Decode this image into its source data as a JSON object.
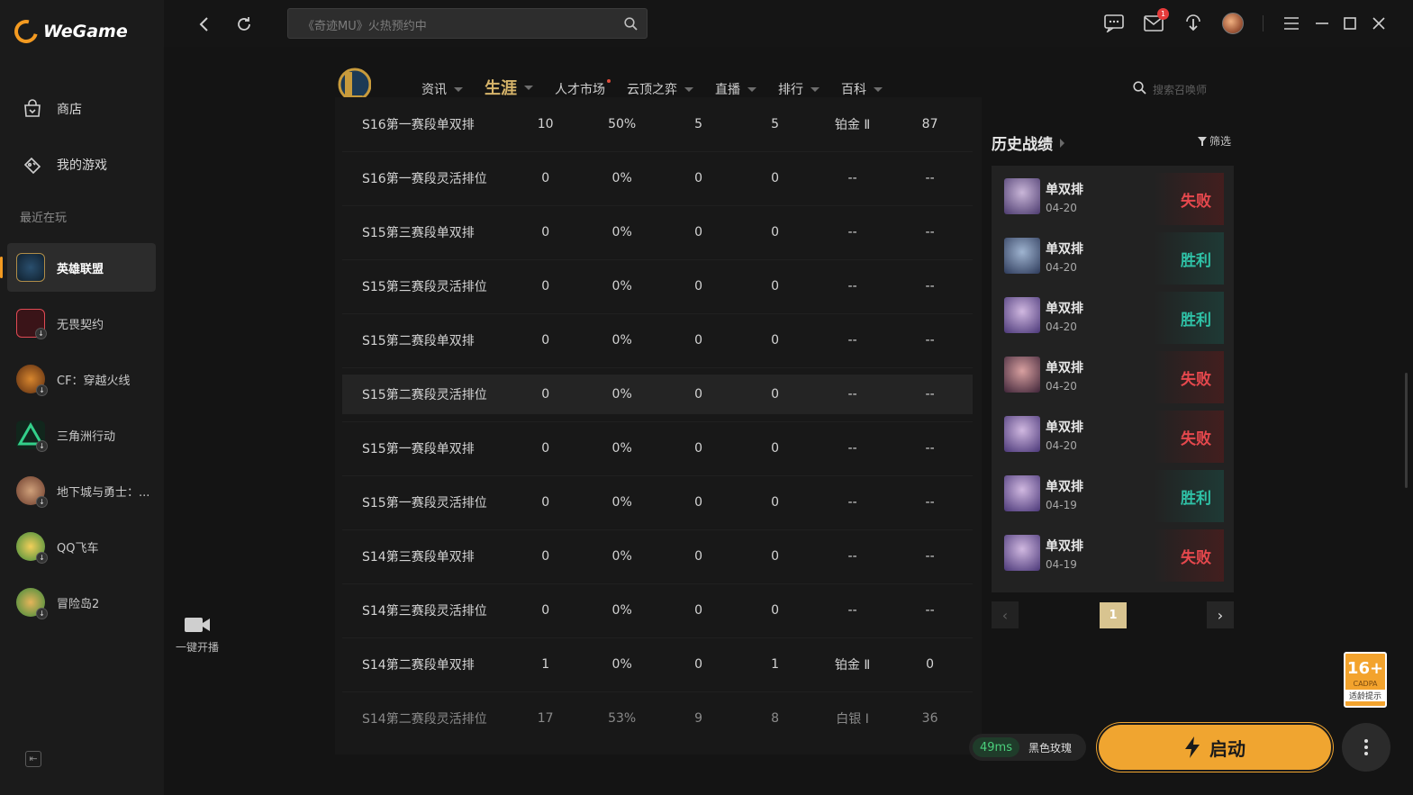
{
  "app": {
    "name": "WeGame"
  },
  "sidebar": {
    "nav": [
      {
        "label": "商店",
        "icon": "store-icon"
      },
      {
        "label": "我的游戏",
        "icon": "gamepad-icon"
      }
    ],
    "recent_label": "最近在玩",
    "games": [
      {
        "label": "英雄联盟",
        "active": true
      },
      {
        "label": "无畏契约"
      },
      {
        "label": "CF：穿越火线"
      },
      {
        "label": "三角洲行动"
      },
      {
        "label": "地下城与勇士：..."
      },
      {
        "label": "QQ飞车"
      },
      {
        "label": "冒险岛2"
      }
    ]
  },
  "topbar": {
    "search_text": "《奇迹MU》火热预约中",
    "mail_badge": "1"
  },
  "live": {
    "label": "一键开播"
  },
  "lol": {
    "tabs": [
      {
        "label": "资讯"
      },
      {
        "label": "生涯",
        "active": true
      },
      {
        "label": "人才市场"
      },
      {
        "label": "云顶之弈"
      },
      {
        "label": "直播"
      },
      {
        "label": "排行"
      },
      {
        "label": "百科"
      }
    ],
    "search_placeholder": "搜索召唤师"
  },
  "career_table": {
    "rows": [
      {
        "season": "S16第一赛段单双排",
        "games": "10",
        "winrate": "50%",
        "wins": "5",
        "losses": "5",
        "tier": "铂金 Ⅱ",
        "points": "87"
      },
      {
        "season": "S16第一赛段灵活排位",
        "games": "0",
        "winrate": "0%",
        "wins": "0",
        "losses": "0",
        "tier": "--",
        "points": "--"
      },
      {
        "season": "S15第三赛段单双排",
        "games": "0",
        "winrate": "0%",
        "wins": "0",
        "losses": "0",
        "tier": "--",
        "points": "--"
      },
      {
        "season": "S15第三赛段灵活排位",
        "games": "0",
        "winrate": "0%",
        "wins": "0",
        "losses": "0",
        "tier": "--",
        "points": "--"
      },
      {
        "season": "S15第二赛段单双排",
        "games": "0",
        "winrate": "0%",
        "wins": "0",
        "losses": "0",
        "tier": "--",
        "points": "--"
      },
      {
        "season": "S15第二赛段灵活排位",
        "games": "0",
        "winrate": "0%",
        "wins": "0",
        "losses": "0",
        "tier": "--",
        "points": "--"
      },
      {
        "season": "S15第一赛段单双排",
        "games": "0",
        "winrate": "0%",
        "wins": "0",
        "losses": "0",
        "tier": "--",
        "points": "--"
      },
      {
        "season": "S15第一赛段灵活排位",
        "games": "0",
        "winrate": "0%",
        "wins": "0",
        "losses": "0",
        "tier": "--",
        "points": "--"
      },
      {
        "season": "S14第三赛段单双排",
        "games": "0",
        "winrate": "0%",
        "wins": "0",
        "losses": "0",
        "tier": "--",
        "points": "--"
      },
      {
        "season": "S14第三赛段灵活排位",
        "games": "0",
        "winrate": "0%",
        "wins": "0",
        "losses": "0",
        "tier": "--",
        "points": "--"
      },
      {
        "season": "S14第二赛段单双排",
        "games": "1",
        "winrate": "0%",
        "wins": "0",
        "losses": "1",
        "tier": "铂金 Ⅱ",
        "points": "0"
      },
      {
        "season": "S14第二赛段灵活排位",
        "games": "17",
        "winrate": "53%",
        "wins": "9",
        "losses": "8",
        "tier": "白银 Ⅰ",
        "points": "36"
      }
    ]
  },
  "history": {
    "title": "历史战绩",
    "filter_label": "筛选",
    "matches": [
      {
        "queue": "单双排",
        "date": "04-20",
        "result": "失败",
        "win": false
      },
      {
        "queue": "单双排",
        "date": "04-20",
        "result": "胜利",
        "win": true
      },
      {
        "queue": "单双排",
        "date": "04-20",
        "result": "胜利",
        "win": true
      },
      {
        "queue": "单双排",
        "date": "04-20",
        "result": "失败",
        "win": false
      },
      {
        "queue": "单双排",
        "date": "04-20",
        "result": "失败",
        "win": false
      },
      {
        "queue": "单双排",
        "date": "04-19",
        "result": "胜利",
        "win": true
      },
      {
        "queue": "单双排",
        "date": "04-19",
        "result": "失败",
        "win": false
      }
    ],
    "page": "1"
  },
  "launch": {
    "ping": "49ms",
    "server": "黑色玫瑰",
    "button_label": "启动"
  },
  "age_rating": {
    "number": "16+",
    "caption": "CADPA",
    "tip": "适龄提示"
  }
}
